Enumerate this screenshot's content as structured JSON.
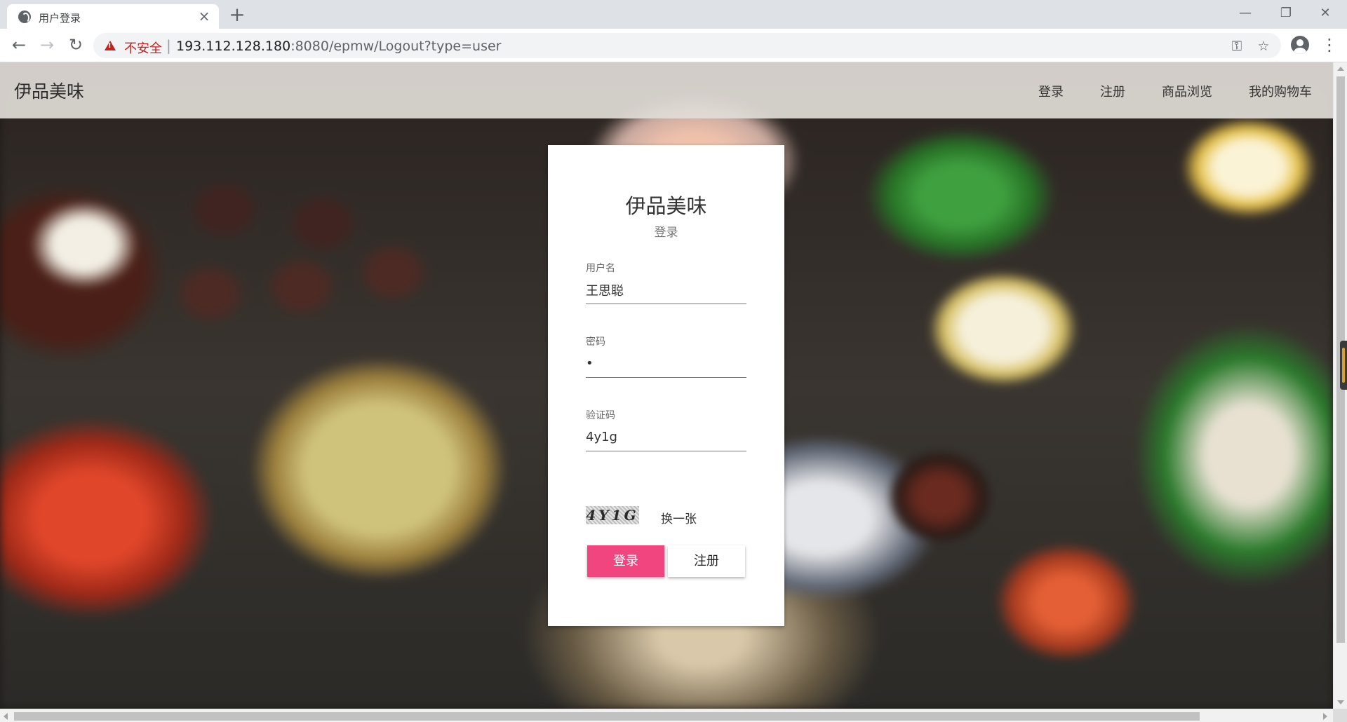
{
  "browser": {
    "tab_title": "用户登录",
    "tab_close_icon": "close-icon",
    "new_tab_label": "+",
    "window_controls": {
      "minimize": "—",
      "restore": "❐",
      "close": "✕"
    },
    "nav": {
      "back": "←",
      "forward": "→",
      "reload": "↻"
    },
    "security_label": "不安全",
    "url_host": "193.112.128.180",
    "url_rest": ":8080/epmw/Logout?type=user",
    "icons": {
      "key": "key-icon",
      "star": "☆",
      "menu": "⋮"
    }
  },
  "site": {
    "brand": "伊品美味",
    "nav": [
      {
        "label": "登录"
      },
      {
        "label": "注册"
      },
      {
        "label": "商品浏览"
      },
      {
        "label": "我的购物车"
      }
    ]
  },
  "login": {
    "title": "伊品美味",
    "subtitle": "登录",
    "username": {
      "label": "用户名",
      "value": "王思聪"
    },
    "password": {
      "label": "密码",
      "value": "•"
    },
    "captcha": {
      "label": "验证码",
      "value": "4y1g",
      "image_text": "4Y1G"
    },
    "refresh_label": "换一张",
    "login_button": "登录",
    "register_button": "注册",
    "colors": {
      "primary": "#f1457f"
    }
  }
}
